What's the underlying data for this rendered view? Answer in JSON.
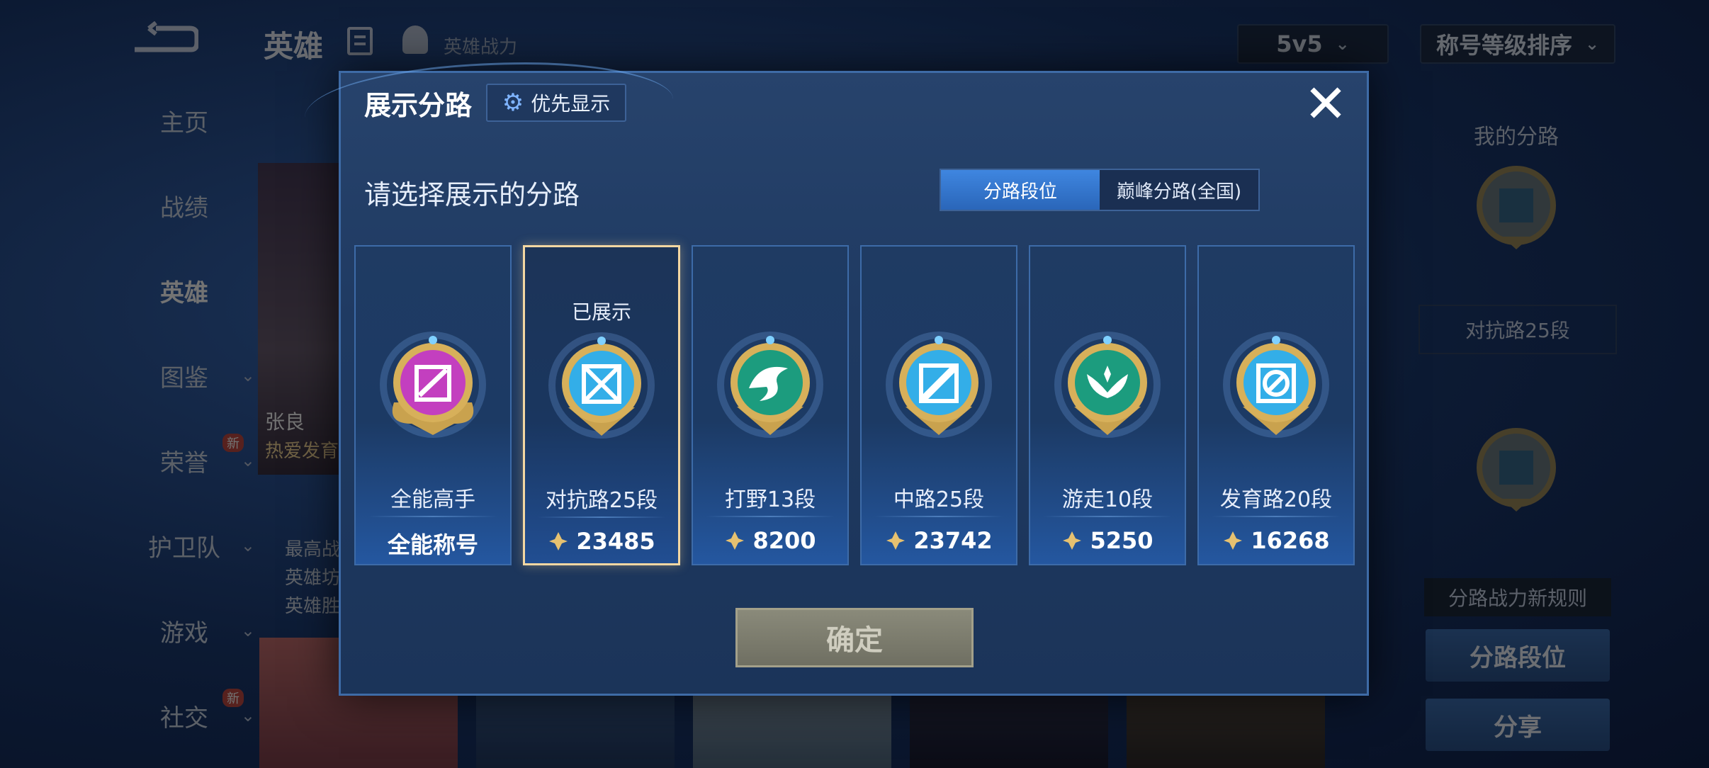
{
  "background": {
    "title": "英雄",
    "power_label": "英雄战力",
    "mode_dropdown": "5v5",
    "sort_dropdown": "称号等级排序",
    "nav": [
      {
        "label": "主页",
        "chevron": false,
        "new": false
      },
      {
        "label": "战绩",
        "chevron": false,
        "new": false
      },
      {
        "label": "英雄",
        "chevron": false,
        "new": false,
        "active": true
      },
      {
        "label": "图鉴",
        "chevron": true,
        "new": false
      },
      {
        "label": "荣誉",
        "chevron": true,
        "new": true
      },
      {
        "label": "护卫队",
        "chevron": true,
        "new": false
      },
      {
        "label": "游戏",
        "chevron": true,
        "new": false
      },
      {
        "label": "社交",
        "chevron": true,
        "new": true
      }
    ],
    "new_badge": "新",
    "hero_name": "张良",
    "hero_sub": "热爱发育",
    "hero_stats": [
      "最高战",
      "英雄坊",
      "英雄胜"
    ],
    "right_panel": {
      "title": "我的分路",
      "rank": "对抗路25段",
      "rule": "分路战力新规则",
      "btn_lane_rank": "分路段位",
      "btn_share": "分享"
    }
  },
  "modal": {
    "title": "展示分路",
    "priority_label": "优先显示",
    "close_label": "✕",
    "prompt": "请选择展示的分路",
    "tabs": [
      {
        "label": "分路段位",
        "active": true
      },
      {
        "label": "巅峰分路(全国)",
        "active": false
      }
    ],
    "lanes": [
      {
        "name": "全能高手",
        "score": "全能称号",
        "shown": "",
        "emblem": "all-rounder",
        "color": "#c33fbf",
        "selected": false,
        "has_power": false
      },
      {
        "name": "对抗路25段",
        "score": "23485",
        "shown": "已展示",
        "emblem": "clash-lane",
        "color": "#33aee8",
        "selected": true,
        "has_power": true
      },
      {
        "name": "打野13段",
        "score": "8200",
        "shown": "",
        "emblem": "jungle",
        "color": "#1c9c7e",
        "selected": false,
        "has_power": true
      },
      {
        "name": "中路25段",
        "score": "23742",
        "shown": "",
        "emblem": "mid-lane",
        "color": "#33aee8",
        "selected": false,
        "has_power": true
      },
      {
        "name": "游走10段",
        "score": "5250",
        "shown": "",
        "emblem": "roam",
        "color": "#1c9c7e",
        "selected": false,
        "has_power": true
      },
      {
        "name": "发育路20段",
        "score": "16268",
        "shown": "",
        "emblem": "farm-lane",
        "color": "#33aee8",
        "selected": false,
        "has_power": true
      }
    ],
    "confirm_label": "确定"
  }
}
